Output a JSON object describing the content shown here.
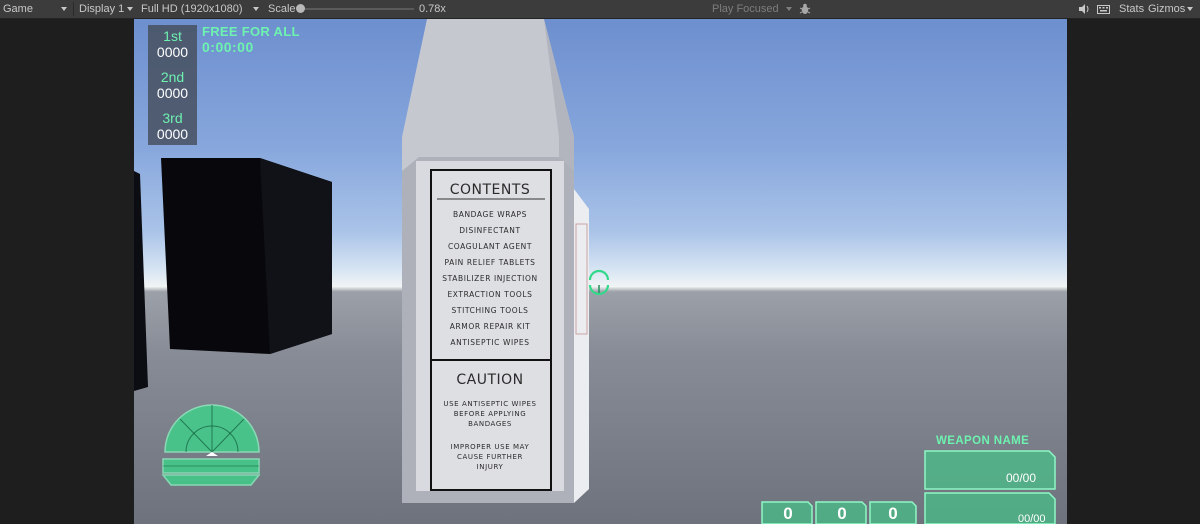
{
  "toolbar": {
    "view_label": "Game",
    "display_label": "Display 1",
    "resolution_label": "Full HD (1920x1080)",
    "scale_label": "Scale",
    "scale_value": "0.78x",
    "scale_fraction": 0.0,
    "play_mode_label": "Play Focused",
    "stats_label": "Stats",
    "gizmos_label": "Gizmos",
    "icons": [
      "bug-icon",
      "speaker-icon",
      "keyboard-icon"
    ]
  },
  "hud": {
    "leaderboard": [
      {
        "place": "1st",
        "score": "0000"
      },
      {
        "place": "2nd",
        "score": "0000"
      },
      {
        "place": "3rd",
        "score": "0000"
      }
    ],
    "mode_title": "FREE FOR ALL",
    "timer": "0:00:00",
    "weapon_name": "WEAPON NAME",
    "ammo_primary": "00/00",
    "ammo_secondary": "00/00",
    "counters": [
      "0",
      "0",
      "0"
    ],
    "accent_color": "#6ef2b0",
    "icons": [
      "radar-icon",
      "crosshair-icon"
    ]
  },
  "crate": {
    "contents_title": "CONTENTS",
    "contents_items": [
      "BANDAGE WRAPS",
      "DISINFECTANT",
      "COAGULANT AGENT",
      "PAIN RELIEF TABLETS",
      "STABILIZER INJECTION",
      "EXTRACTION TOOLS",
      "STITCHING TOOLS",
      "ARMOR REPAIR KIT",
      "ANTISEPTIC WIPES"
    ],
    "caution_title": "CAUTION",
    "caution_lines": [
      "USE ANTISEPTIC WIPES",
      "BEFORE APPLYING",
      "BANDAGES",
      "IMPROPER USE MAY",
      "CAUSE FURTHER",
      "INJURY"
    ]
  }
}
